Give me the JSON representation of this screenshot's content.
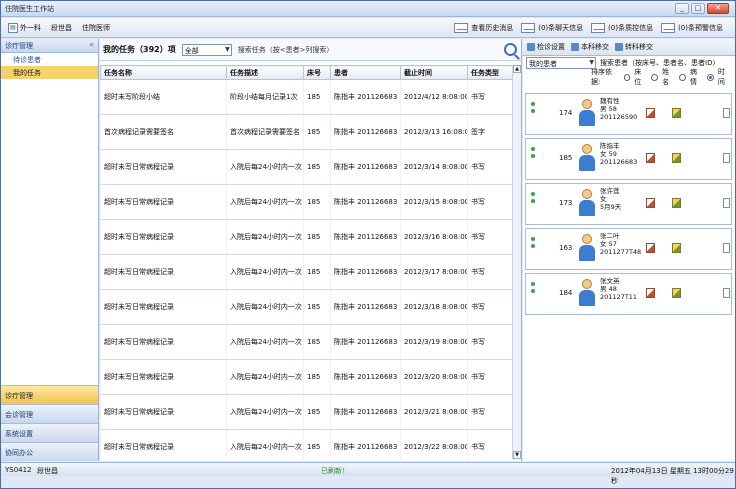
{
  "window": {
    "title": "住院医生工作站",
    "controls": [
      "_",
      "□",
      "✕"
    ]
  },
  "toolbar": {
    "left": [
      {
        "label": "外一科",
        "icon": "department-icon"
      },
      {
        "label": "段世昌",
        "icon": ""
      },
      {
        "label": "住院医师",
        "icon": ""
      }
    ],
    "right": [
      {
        "label": "查看历史消息"
      },
      {
        "label": "(0)条聊天信息"
      },
      {
        "label": "(0)条质控信息"
      },
      {
        "label": "(0)条预警信息"
      }
    ]
  },
  "nav": {
    "header": "诊疗管理",
    "collapse": "«",
    "items": [
      {
        "label": "待诊患者",
        "selected": false
      },
      {
        "label": "我的任务",
        "selected": true
      }
    ],
    "sections": [
      {
        "label": "诊疗管理",
        "selected": true
      },
      {
        "label": "会诊管理",
        "selected": false
      },
      {
        "label": "系统设置",
        "selected": false
      },
      {
        "label": "协同办公",
        "selected": false
      }
    ]
  },
  "tasks": {
    "title": "我的任务（392）项",
    "filter": "全部",
    "search_hint": "搜索任务（按<患者>列搜索）",
    "columns": [
      "任务名称",
      "任务描述",
      "床号",
      "患者",
      "截止时间",
      "任务类型"
    ],
    "rows": [
      [
        "超时未写阶段小结",
        "阶段小结每月记录1次",
        "185",
        "陈指丰 201126683",
        "2012/4/12 8:08:00",
        "书写"
      ],
      [
        "首次病程记录需要签名",
        "首次病程记录需要签名",
        "185",
        "陈指丰 201126683",
        "2012/3/13 16:08:00",
        "签字"
      ],
      [
        "超时未写日常病程记录",
        "入院后每24小时内一次",
        "185",
        "陈指丰 201126683",
        "2012/3/14 8:08:00",
        "书写"
      ],
      [
        "超时未写日常病程记录",
        "入院后每24小时内一次",
        "185",
        "陈指丰 201126683",
        "2012/3/15 8:08:00",
        "书写"
      ],
      [
        "超时未写日常病程记录",
        "入院后每24小时内一次",
        "185",
        "陈指丰 201126683",
        "2012/3/16 8:08:00",
        "书写"
      ],
      [
        "超时未写日常病程记录",
        "入院后每24小时内一次",
        "185",
        "陈指丰 201126683",
        "2012/3/17 8:08:00",
        "书写"
      ],
      [
        "超时未写日常病程记录",
        "入院后每24小时内一次",
        "185",
        "陈指丰 201126683",
        "2012/3/18 8:08:00",
        "书写"
      ],
      [
        "超时未写日常病程记录",
        "入院后每24小时内一次",
        "185",
        "陈指丰 201126683",
        "2012/3/19 8:08:00",
        "书写"
      ],
      [
        "超时未写日常病程记录",
        "入院后每24小时内一次",
        "185",
        "陈指丰 201126683",
        "2012/3/20 8:08:00",
        "书写"
      ],
      [
        "超时未写日常病程记录",
        "入院后每24小时内一次",
        "185",
        "陈指丰 201126683",
        "2012/3/21 8:08:00",
        "书写"
      ],
      [
        "超时未写日常病程记录",
        "入院后每24小时内一次",
        "185",
        "陈指丰 201126683",
        "2012/3/22 8:08:00",
        "书写"
      ]
    ]
  },
  "right": {
    "tabs": [
      "检诊设置",
      "本科移交",
      "转科移交"
    ],
    "patient_filter": "我的患者",
    "search_hint": "搜索患者（按床号、患者名、患者ID）",
    "sort_label": "排序依据:",
    "sort_options": [
      {
        "label": "床位",
        "on": false
      },
      {
        "label": "姓名",
        "on": false
      },
      {
        "label": "病情",
        "on": false
      },
      {
        "label": "时间",
        "on": true
      }
    ],
    "patients": [
      {
        "bed": "174",
        "name": "魏有性",
        "line2": "男  58",
        "id": "201126590"
      },
      {
        "bed": "185",
        "name": "陈指丰",
        "line2": "女  59",
        "id": "201126683"
      },
      {
        "bed": "173",
        "name": "张许莲",
        "line2": "女",
        "id": "5月9天"
      },
      {
        "bed": "163",
        "name": "张二叶",
        "line2": "女  57",
        "id": "2011277T48"
      },
      {
        "bed": "184",
        "name": "张文英",
        "line2": "男  48",
        "id": "201127T11"
      }
    ]
  },
  "status": {
    "user_code": "YS0412",
    "user_name": "段世昌",
    "message": "已刷新！",
    "datetime": "2012年04月13日 星期五 13时00分29秒"
  }
}
